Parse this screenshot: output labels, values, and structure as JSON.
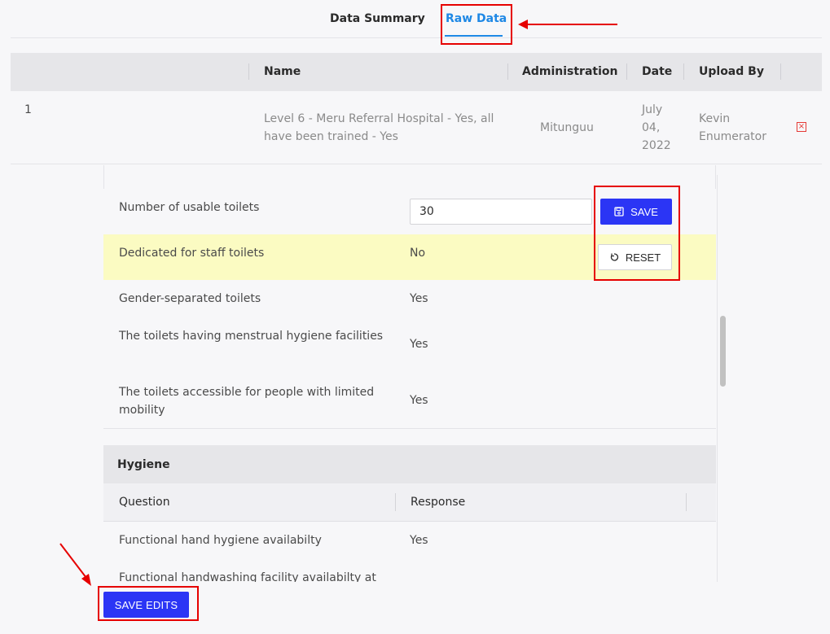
{
  "tabs": [
    {
      "label": "Data Summary",
      "active": false
    },
    {
      "label": "Raw Data",
      "active": true
    }
  ],
  "table": {
    "columns": [
      "Name",
      "Administration",
      "Date",
      "Upload By"
    ],
    "row": {
      "index": "1",
      "name": "Level 6 - Meru Referral Hospital - Yes, all have been trained - Yes",
      "administration": "Mitunguu",
      "date": "July 04, 2022",
      "upload_by": "Kevin Enumerator"
    }
  },
  "questions": [
    {
      "label": "Number of usable toilets",
      "value": "30"
    },
    {
      "label": "Dedicated for staff toilets",
      "value": "No"
    },
    {
      "label": "Gender-separated toilets",
      "value": "Yes"
    },
    {
      "label": "The toilets having menstrual hygiene facilities",
      "value": "Yes"
    },
    {
      "label": "The toilets accessible for people with limited mobility",
      "value": "Yes"
    }
  ],
  "buttons": {
    "save": "SAVE",
    "reset": "RESET",
    "save_edits": "SAVE EDITS"
  },
  "hygiene": {
    "title": "Hygiene",
    "columns": [
      "Question",
      "Response"
    ],
    "rows": [
      {
        "label": "Functional hand hygiene availabilty",
        "value": "Yes"
      },
      {
        "label": "Functional handwashing facility availabilty at",
        "value": ""
      }
    ]
  },
  "colors": {
    "accent": "#1e88e5",
    "primary_button": "#2b35f5",
    "highlight": "#fbfbc2",
    "annotation": "#e60000"
  }
}
